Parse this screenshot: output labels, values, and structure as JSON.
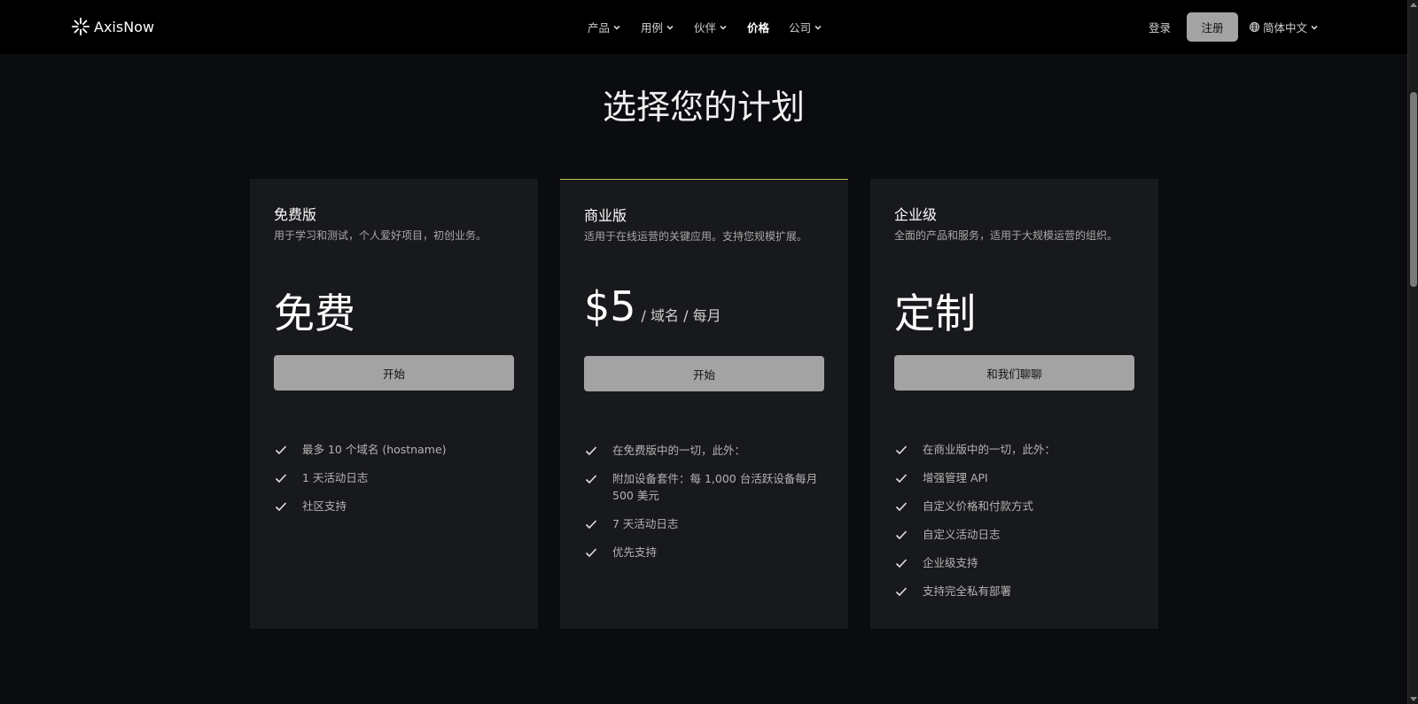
{
  "nav": {
    "brand": "AxisNow",
    "items": [
      {
        "label": "产品",
        "dropdown": true
      },
      {
        "label": "用例",
        "dropdown": true
      },
      {
        "label": "伙伴",
        "dropdown": true
      },
      {
        "label": "价格",
        "dropdown": false,
        "active": true
      },
      {
        "label": "公司",
        "dropdown": true
      }
    ],
    "login": "登录",
    "signup": "注册",
    "language": "简体中文"
  },
  "title": "选择您的计划",
  "plans": [
    {
      "name": "免费版",
      "description": "用于学习和测试，个人爱好项目，初创业务。",
      "price": "免费",
      "price_suffix": "",
      "cta": "开始",
      "features": [
        "最多 10 个域名 (hostname)",
        "1 天活动日志",
        "社区支持"
      ]
    },
    {
      "name": "商业版",
      "description": "适用于在线运营的关键应用。支持您规模扩展。",
      "price": "$5",
      "price_suffix": "/ 域名 / 每月",
      "cta": "开始",
      "features": [
        "在免费版中的一切，此外：",
        "附加设备套件：每 1,000 台活跃设备每月 500 美元",
        "7 天活动日志",
        "优先支持"
      ]
    },
    {
      "name": "企业级",
      "description": "全面的产品和服务，适用于大规模运营的组织。",
      "price": "定制",
      "price_suffix": "",
      "cta": "和我们聊聊",
      "features": [
        "在商业版中的一切，此外：",
        "增强管理 API",
        "自定义价格和付款方式",
        "自定义活动日志",
        "企业级支持",
        "支持完全私有部署"
      ]
    }
  ],
  "colors": {
    "background": "#0b0c10",
    "navbar": "#000000",
    "card": "#18191c",
    "button": "#a3a3a3",
    "highlight_border": "#b7c35a"
  },
  "icons": {
    "brand": "axisnow-logo-icon",
    "dropdown": "chevron-down-icon",
    "language": "globe-icon",
    "feature": "check-icon"
  }
}
